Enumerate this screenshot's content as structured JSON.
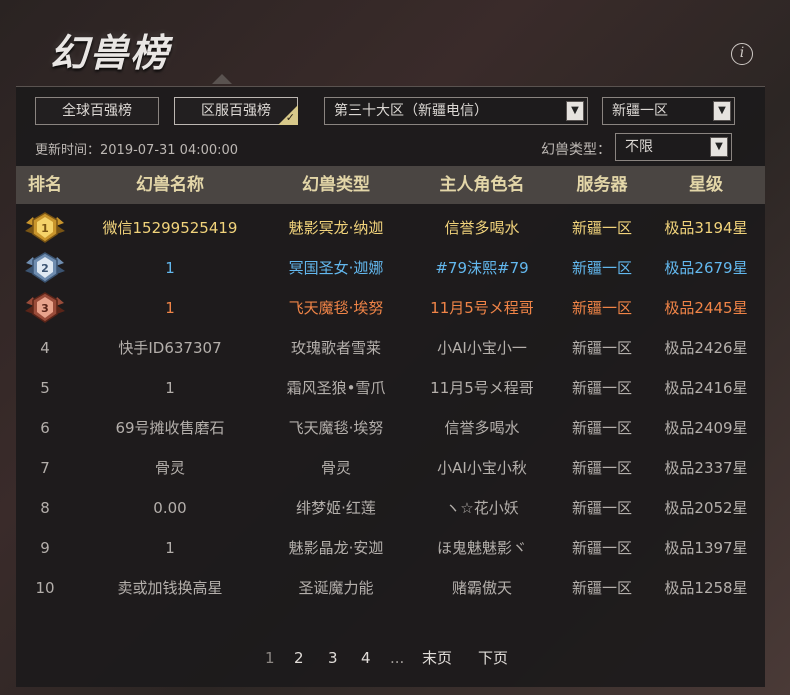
{
  "page_title": "幻兽榜",
  "tabs": [
    {
      "label": "全球百强榜",
      "selected": false
    },
    {
      "label": "区服百强榜",
      "selected": true
    }
  ],
  "filters": {
    "region": "第三十大区（新疆电信）",
    "server": "新疆一区",
    "type_label": "幻兽类型：",
    "type_value": "不限"
  },
  "update_time": "更新时间：2019-07-31 04:00:00",
  "table": {
    "headers": [
      "排名",
      "幻兽名称",
      "幻兽类型",
      "主人角色名",
      "服务器",
      "星级"
    ],
    "rows": [
      {
        "rank": "1",
        "name": "微信15299525419",
        "type": "魅影冥龙·纳迦",
        "owner": "信誉多喝水",
        "server": "新疆一区",
        "star": "极品3194星",
        "tier": "gold"
      },
      {
        "rank": "2",
        "name": "1",
        "type": "冥国圣女·迦娜",
        "owner": "#79沫熙#79",
        "server": "新疆一区",
        "star": "极品2679星",
        "tier": "silver"
      },
      {
        "rank": "3",
        "name": "1",
        "type": "飞天魔毯·埃努",
        "owner": "11月5号メ程哥",
        "server": "新疆一区",
        "star": "极品2445星",
        "tier": "bronze"
      },
      {
        "rank": "4",
        "name": "快手ID637307",
        "type": "玫瑰歌者雪莱",
        "owner": "小AI小宝小一",
        "server": "新疆一区",
        "star": "极品2426星",
        "tier": "normal"
      },
      {
        "rank": "5",
        "name": "1",
        "type": "霜风圣狼•雪爪",
        "owner": "11月5号メ程哥",
        "server": "新疆一区",
        "star": "极品2416星",
        "tier": "normal"
      },
      {
        "rank": "6",
        "name": "69号摊收售磨石",
        "type": "飞天魔毯·埃努",
        "owner": "信誉多喝水",
        "server": "新疆一区",
        "star": "极品2409星",
        "tier": "normal"
      },
      {
        "rank": "7",
        "name": "骨灵",
        "type": "骨灵",
        "owner": "小AI小宝小秋",
        "server": "新疆一区",
        "star": "极品2337星",
        "tier": "normal"
      },
      {
        "rank": "8",
        "name": "0.00",
        "type": "绯梦姬·红莲",
        "owner": "ヽ☆花小妖",
        "server": "新疆一区",
        "star": "极品2052星",
        "tier": "normal"
      },
      {
        "rank": "9",
        "name": "1",
        "type": "魅影晶龙·安迦",
        "owner": "ほ鬼魅魅影ヾ",
        "server": "新疆一区",
        "star": "极品1397星",
        "tier": "normal"
      },
      {
        "rank": "10",
        "name": "卖或加钱换高星",
        "type": "圣诞魔力能",
        "owner": "赌霸傲天",
        "server": "新疆一区",
        "star": "极品1258星",
        "tier": "normal"
      }
    ]
  },
  "pagination": {
    "pages": [
      "1",
      "2",
      "3",
      "4"
    ],
    "current": "1",
    "ellipsis": "...",
    "last_label": "末页",
    "next_label": "下页"
  },
  "colors": {
    "gold": "#f1d37b",
    "silver": "#63b8ee",
    "bronze": "#f08447",
    "header_text": "#e3d6a8"
  },
  "icons": {
    "info": "info-icon",
    "dropdown": "chevron-down-icon",
    "tab_selected": "checkmark-icon",
    "rank_1": "gold-medal-icon",
    "rank_2": "silver-medal-icon",
    "rank_3": "bronze-medal-icon"
  }
}
